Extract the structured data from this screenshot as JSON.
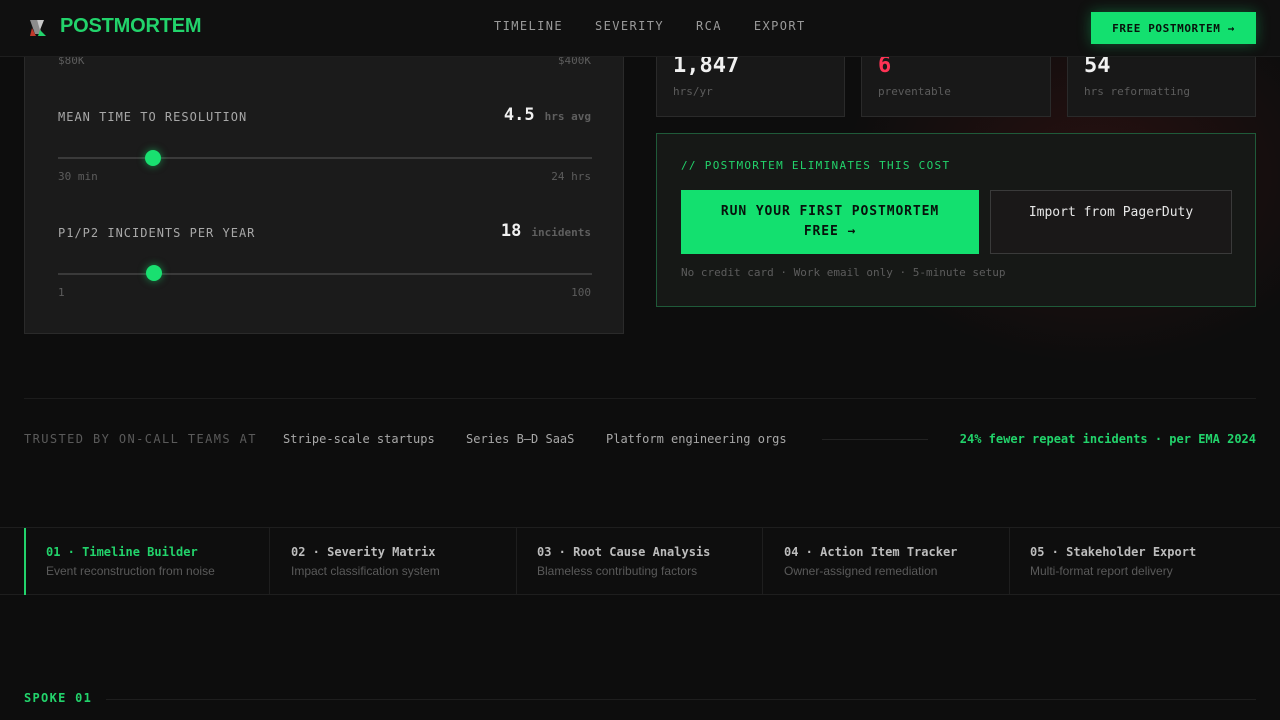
{
  "brand": {
    "name": "POSTMORTEM",
    "logo_icon": "prism-logo-icon"
  },
  "nav": [
    {
      "label": "TIMELINE"
    },
    {
      "label": "SEVERITY"
    },
    {
      "label": "RCA"
    },
    {
      "label": "EXPORT"
    }
  ],
  "header_cta": "FREE POSTMORTEM →",
  "calculator": {
    "top_range": {
      "min": "$80K",
      "max": "$400K"
    },
    "mttr": {
      "label": "MEAN TIME TO RESOLUTION",
      "value": "4.5",
      "unit": "hrs avg",
      "min": "30 min",
      "max": "24 hrs"
    },
    "incidents": {
      "label": "P1/P2 INCIDENTS PER YEAR",
      "value": "18",
      "unit": "incidents",
      "min": "1",
      "max": "100"
    }
  },
  "stats": [
    {
      "value": "1,847",
      "label": "hrs/yr"
    },
    {
      "value": "6",
      "label": "preventable"
    },
    {
      "value": "54",
      "label": "hrs reformatting"
    }
  ],
  "cta_panel": {
    "title": "// POSTMORTEM ELIMINATES THIS COST",
    "primary_line1": "RUN YOUR FIRST POSTMORTEM",
    "primary_line2": "FREE →",
    "secondary": "Import from PagerDuty",
    "note": "No credit card · Work email only · 5-minute setup"
  },
  "trusted": {
    "label": "TRUSTED BY ON-CALL TEAMS AT",
    "items": [
      "Stripe-scale startups",
      "Series B–D SaaS",
      "Platform engineering orgs"
    ],
    "stat": "24% fewer repeat incidents · per EMA 2024"
  },
  "tabs": [
    {
      "title": "01 · Timeline Builder",
      "sub": "Event reconstruction from noise"
    },
    {
      "title": "02 · Severity Matrix",
      "sub": "Impact classification system"
    },
    {
      "title": "03 · Root Cause Analysis",
      "sub": "Blameless contributing factors"
    },
    {
      "title": "04 · Action Item Tracker",
      "sub": "Owner-assigned remediation"
    },
    {
      "title": "05 · Stakeholder Export",
      "sub": "Multi-format report delivery"
    }
  ],
  "spoke_label": "SPOKE 01",
  "colors": {
    "accent": "#13e06f",
    "danger": "#ff3355",
    "bg": "#0d0d0d"
  }
}
